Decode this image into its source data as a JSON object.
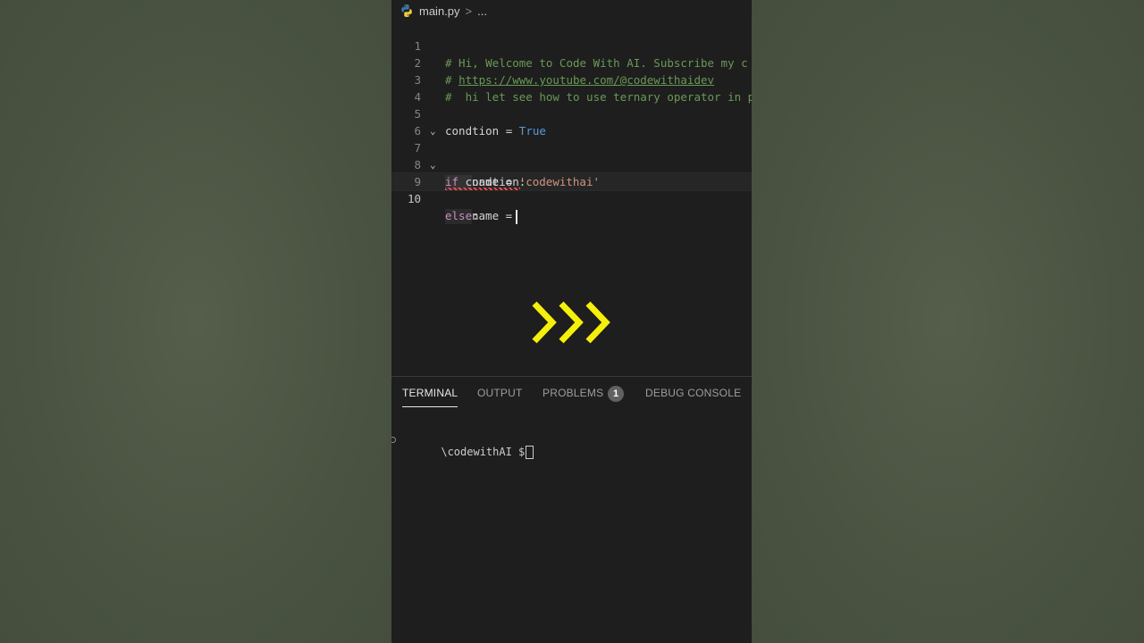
{
  "breadcrumb": {
    "filename": "main.py",
    "separator": ">",
    "more": "..."
  },
  "editor": {
    "line_numbers": [
      "1",
      "2",
      "3",
      "4",
      "5",
      "6",
      "7",
      "8",
      "9",
      "10"
    ],
    "lines": {
      "l1": "# Hi, Welcome to Code With AI. Subscribe my c",
      "l2_hash": "# ",
      "l2_url": "https://www.youtube.com/@codewithaidev",
      "l3": "#  hi let see how to use ternary operator in p",
      "l5_var": "condtion",
      "l5_eq": " = ",
      "l5_val": "True",
      "l7_kw": "if",
      "l7_rest": " condtion:",
      "l8_var": "name",
      "l8_eq": " = ",
      "l8_val": "'codewithai'",
      "l9_kw": "else",
      "l9_rest": ":",
      "l10_var": "name",
      "l10_eq": " ="
    }
  },
  "panel": {
    "tabs": [
      "TERMINAL",
      "OUTPUT",
      "PROBLEMS",
      "DEBUG CONSOLE"
    ],
    "problems_count": "1",
    "terminal_prompt": "\\codewithAI $"
  },
  "colors": {
    "arrow_yellow": "#f5f00a",
    "comment": "#6a9955",
    "keyword": "#c586c0",
    "boolean": "#569cd6",
    "string": "#ce9178"
  }
}
